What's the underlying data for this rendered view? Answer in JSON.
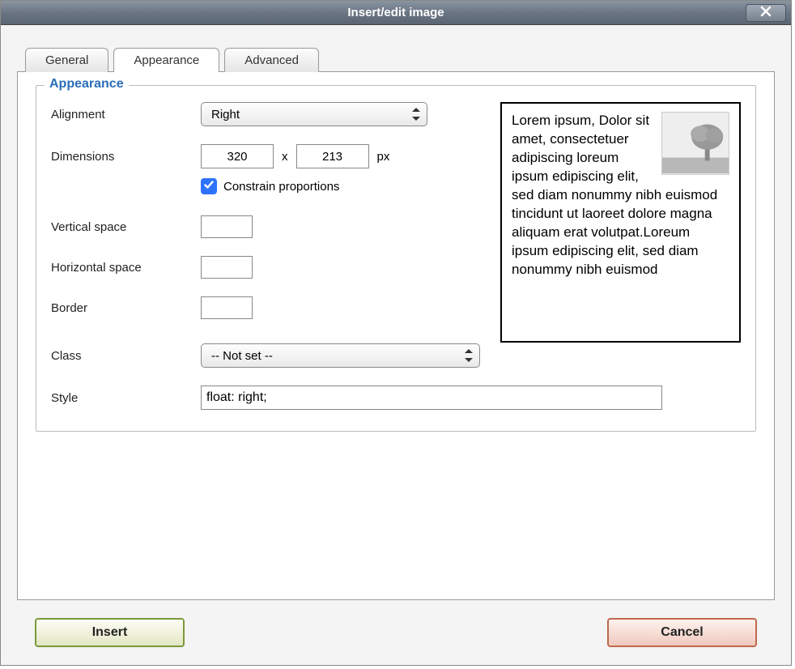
{
  "dialog": {
    "title": "Insert/edit image"
  },
  "tabs": {
    "general": "General",
    "appearance": "Appearance",
    "advanced": "Advanced",
    "active": "appearance"
  },
  "fieldset": {
    "legend": "Appearance"
  },
  "fields": {
    "alignment_label": "Alignment",
    "alignment_value": "Right",
    "dimensions_label": "Dimensions",
    "width": "320",
    "height": "213",
    "dim_separator": "x",
    "dim_unit": "px",
    "constrain_label": "Constrain proportions",
    "constrain_checked": true,
    "vspace_label": "Vertical space",
    "vspace_value": "",
    "hspace_label": "Horizontal space",
    "hspace_value": "",
    "border_label": "Border",
    "border_value": "",
    "class_label": "Class",
    "class_value": "-- Not set --",
    "style_label": "Style",
    "style_value": "float: right;"
  },
  "preview": {
    "text": "Lorem ipsum, Dolor sit amet, consectetuer adipiscing loreum ipsum edipiscing elit, sed diam nonummy nibh euismod tincidunt ut laoreet dolore magna aliquam erat volutpat.Loreum ipsum edipiscing elit, sed diam nonummy nibh euismod"
  },
  "buttons": {
    "insert": "Insert",
    "cancel": "Cancel"
  }
}
